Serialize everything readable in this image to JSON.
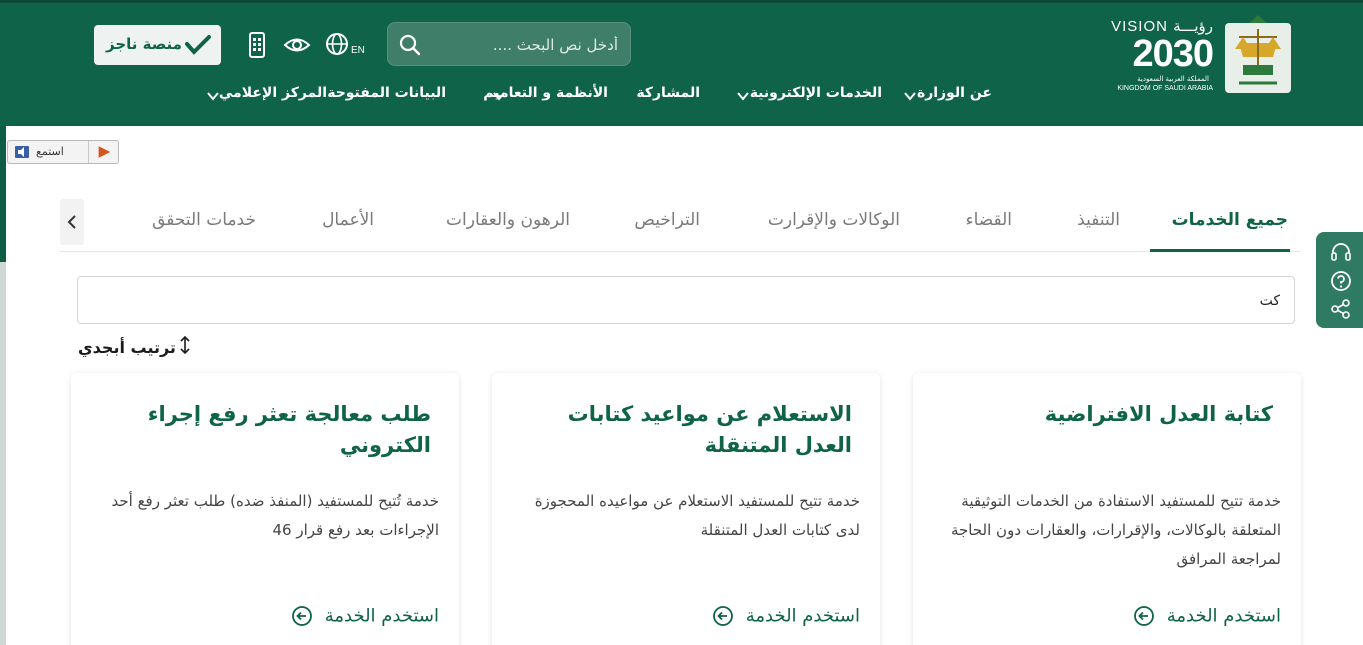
{
  "header": {
    "vision": {
      "line1": "VISION رؤيـــة",
      "line2": "2030",
      "line3": "المملكة العربية السعودية",
      "line4": "KINGDOM OF SAUDI ARABIA"
    },
    "search": {
      "placeholder": "أدخل نص البحث ...."
    },
    "lang_label": "EN",
    "najiz_label": "منصة ناجز",
    "nav": [
      {
        "label": "عن الوزارة",
        "dropdown": true
      },
      {
        "label": "الخدمات الإلكترونية",
        "dropdown": true
      },
      {
        "label": "المشاركة",
        "dropdown": false
      },
      {
        "label": "الأنظمة و التعاميم",
        "dropdown": true
      },
      {
        "label": "البيانات المفتوحة",
        "dropdown": false
      },
      {
        "label": "المركز الإعلامي",
        "dropdown": true
      }
    ]
  },
  "listen": {
    "label": "استمع"
  },
  "tabs": [
    {
      "label": "جميع الخدمات",
      "active": true
    },
    {
      "label": "التنفيذ",
      "active": false
    },
    {
      "label": "القضاء",
      "active": false
    },
    {
      "label": "الوكالات والإقرارت",
      "active": false
    },
    {
      "label": "التراخيص",
      "active": false
    },
    {
      "label": "الرهون والعقارات",
      "active": false
    },
    {
      "label": "الأعمال",
      "active": false
    },
    {
      "label": "خدمات التحقق",
      "active": false
    }
  ],
  "filter": {
    "value": "كت"
  },
  "sort": {
    "label": "ترتيب أبجدي"
  },
  "cards": [
    {
      "title": "كتابة العدل الافتراضية",
      "description": "خدمة تتيح للمستفيد الاستفادة من الخدمات التوثيقية المتعلقة بالوكالات، والإقرارات، والعقارات دون الحاجة لمراجعة المرافق",
      "link": "استخدم الخدمة"
    },
    {
      "title": "الاستعلام عن مواعيد كتابات العدل المتنقلة",
      "description": "خدمة تتيح للمستفيد الاستعلام عن مواعيده المحجوزة لدى كتابات العدل المتنقلة",
      "link": "استخدم الخدمة"
    },
    {
      "title": "طلب معالجة تعثر رفع إجراء الكتروني",
      "description": "خدمة تُتيح للمستفيد (المنفذ ضده) طلب تعثر رفع أحد الإجراءات بعد رفع قرار 46",
      "link": "استخدم الخدمة"
    }
  ],
  "colors": {
    "brand": "#0f6348",
    "header_bg": "#0f6348",
    "side_panel": "#2f7a62"
  }
}
